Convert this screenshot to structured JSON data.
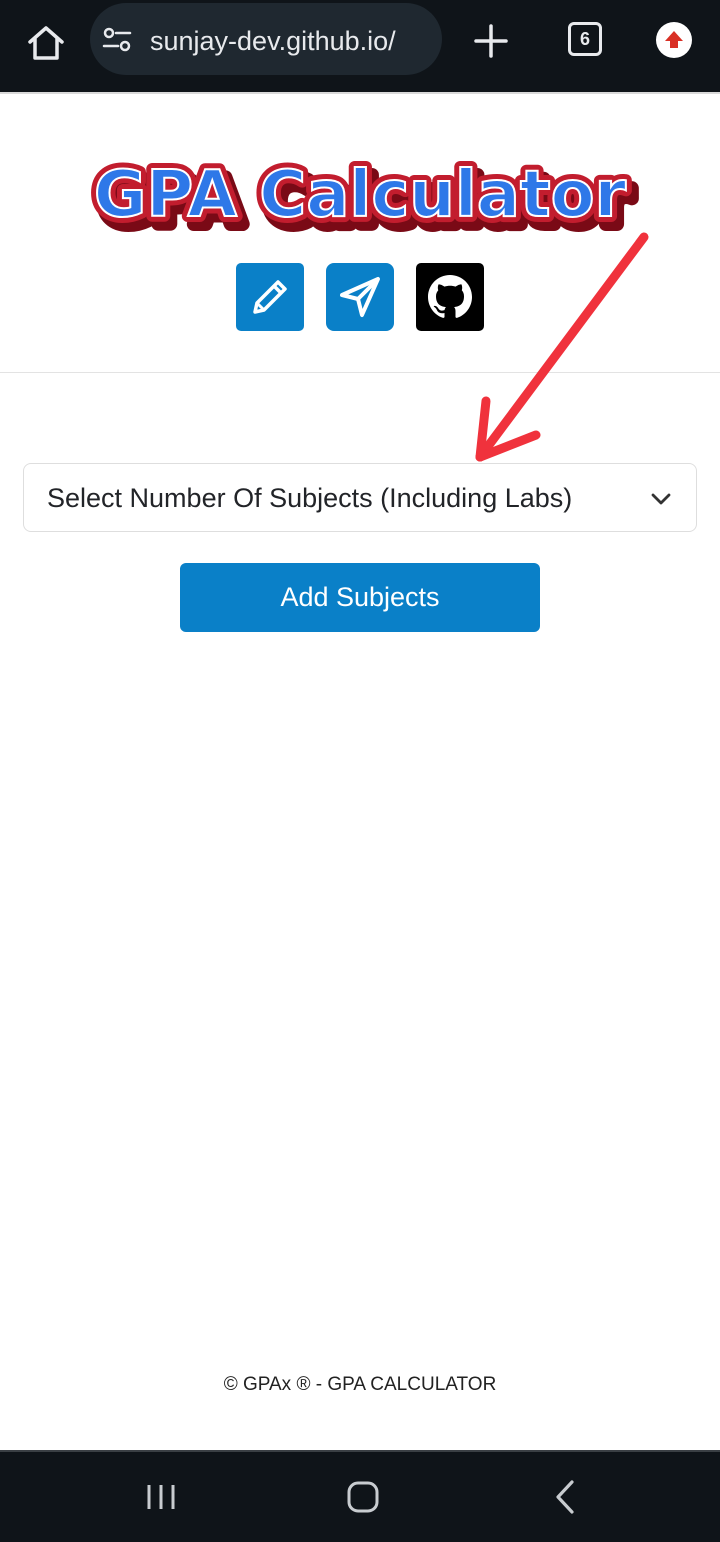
{
  "browser": {
    "url": "sunjay-dev.github.io/",
    "tab_count": "6",
    "icons": [
      "home-icon",
      "site-settings-icon",
      "new-tab-icon",
      "tab-switcher-icon",
      "update-icon"
    ]
  },
  "header": {
    "logo_text": "GPA Calculator",
    "links": [
      {
        "name": "edit",
        "icon": "pencil-icon",
        "color": "#0a80c8"
      },
      {
        "name": "telegram",
        "icon": "paper-plane-icon",
        "color": "#0a80c8"
      },
      {
        "name": "github",
        "icon": "github-icon",
        "color": "#000000"
      }
    ]
  },
  "form": {
    "select_label": "Select Number Of Subjects (Including Labs)",
    "add_button": "Add Subjects"
  },
  "footer": {
    "text": "© GPAx ® - GPA CALCULATOR"
  },
  "annotation": {
    "arrow_color": "#f0323c"
  },
  "colors": {
    "primary": "#0a80c8",
    "logo_blue": "#2e78e8",
    "logo_red": "#c21d2e",
    "system_bar": "#0f1419"
  }
}
